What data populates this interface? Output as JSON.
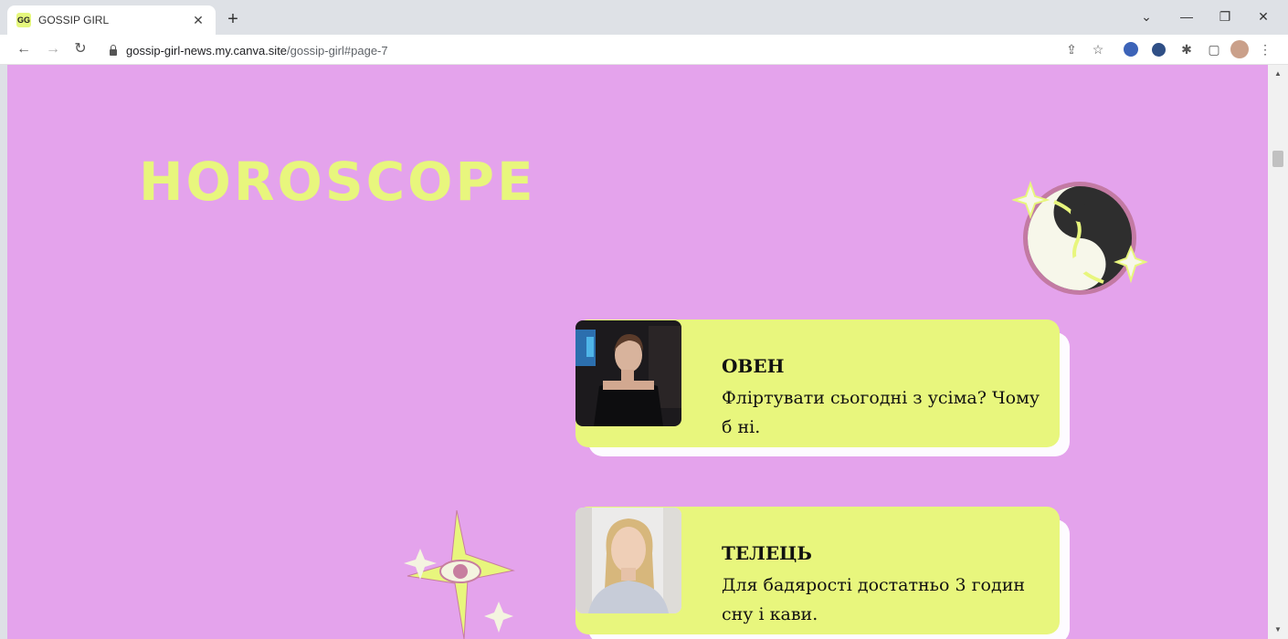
{
  "browser": {
    "tab_title": "GOSSIP GIRL",
    "tab_favicon_text": "GG",
    "url_host": "gossip-girl-news.my.canva.site",
    "url_path": "/gossip-girl#page-7"
  },
  "page": {
    "heading": "HOROSCOPE",
    "cards": [
      {
        "title": "ОВЕН",
        "text": "Фліртувати сьогодні з усіма? Чому б ні."
      },
      {
        "title": "ТЕЛЕЦЬ",
        "text": "Для бадярості достатньо 3 годин сну і кави."
      }
    ]
  },
  "colors": {
    "page_bg": "#e4a3ec",
    "accent_yellow": "#e8f67d",
    "card_shadow": "#fdfbff"
  }
}
